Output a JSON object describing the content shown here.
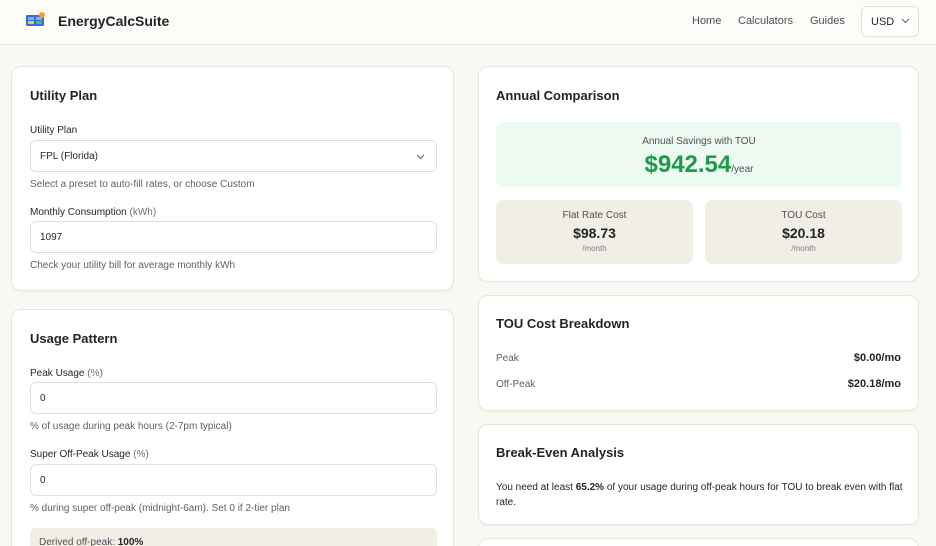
{
  "nav": {
    "brand": "EnergyCalcSuite",
    "logo_icon": "solar-panel-icon",
    "links": [
      "Home",
      "Calculators",
      "Guides"
    ],
    "currency": "USD"
  },
  "utility_plan": {
    "title": "Utility Plan",
    "plan_label": "Utility Plan",
    "plan_value": "FPL (Florida)",
    "plan_help": "Select a preset to auto-fill rates, or choose Custom",
    "consumption_label": "Monthly Consumption",
    "consumption_unit": "(kWh)",
    "consumption_value": "1097",
    "consumption_help": "Check your utility bill for average monthly kWh"
  },
  "usage_pattern": {
    "title": "Usage Pattern",
    "peak_label": "Peak Usage",
    "peak_unit": "(%)",
    "peak_value": "0",
    "peak_help": "% of usage during peak hours (2-7pm typical)",
    "super_label": "Super Off-Peak Usage",
    "super_unit": "(%)",
    "super_value": "0",
    "super_help": "% during super off-peak (midnight-6am). Set 0 if 2-tier plan",
    "derived_label": "Derived off-peak:",
    "derived_value": "100%"
  },
  "annual": {
    "title": "Annual Comparison",
    "savings_label": "Annual Savings with TOU",
    "savings_value": "$942.54",
    "savings_per": "/year",
    "flat_label": "Flat Rate Cost",
    "flat_value": "$98.73",
    "flat_per": "/month",
    "tou_label": "TOU Cost",
    "tou_value": "$20.18",
    "tou_per": "/month"
  },
  "breakdown": {
    "title": "TOU Cost Breakdown",
    "rows": [
      {
        "label": "Peak",
        "value": "$0.00/mo"
      },
      {
        "label": "Off-Peak",
        "value": "$20.18/mo"
      }
    ]
  },
  "breakeven": {
    "title": "Break-Even Analysis",
    "text_before": "You need at least ",
    "highlight": "65.2%",
    "text_after": " of your usage during off-peak hours for TOU to break even with flat rate."
  },
  "colors": {
    "accent_green": "#1a9a4a",
    "page_bg": "#faf8f3",
    "savings_bg": "#edfaf1",
    "cost_bg": "#f1eee5"
  }
}
